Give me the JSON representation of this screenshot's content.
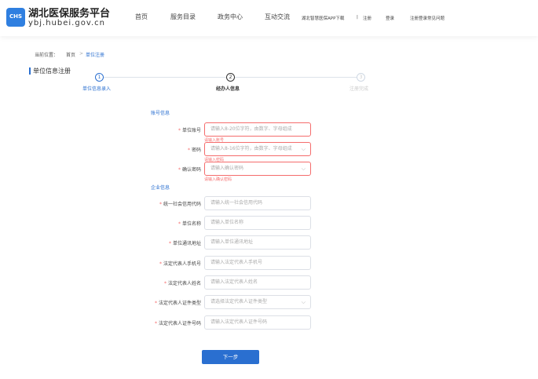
{
  "header": {
    "logo_text": "CHS",
    "title": "湖北医保服务平台",
    "domain": "ybj.hubei.gov.cn",
    "nav": [
      "首页",
      "服务目录",
      "政务中心",
      "互动交流"
    ],
    "links": {
      "app": "湖北智慧医保APP下载",
      "sep": "|",
      "register": "注册",
      "login": "登录",
      "faq": "注册登录常见问题"
    }
  },
  "breadcrumb": {
    "prefix": "当前位置：",
    "home": "首页",
    "sep": ">",
    "current": "单位注册"
  },
  "section_title": "单位信息注册",
  "steps": [
    {
      "num": "1",
      "label": "单位信息录入"
    },
    {
      "num": "2",
      "label": "经办人信息"
    },
    {
      "num": "3",
      "label": "注册完成"
    }
  ],
  "account": {
    "title": "账号信息",
    "fields": [
      {
        "label": "单位账号",
        "placeholder": "请输入8-20位字符，由数字、字母组成",
        "error": "请输入账号"
      },
      {
        "label": "密码",
        "placeholder": "请输入8-16位字符，由数字、字母组成",
        "error": "请输入密码"
      },
      {
        "label": "确认密码",
        "placeholder": "请输入确认密码",
        "error": "请输入确认密码"
      }
    ]
  },
  "company": {
    "title": "企业信息",
    "fields": [
      {
        "label": "统一社会信用代码",
        "placeholder": "请输入统一社会信用代码"
      },
      {
        "label": "单位名称",
        "placeholder": "请输入单位名称"
      },
      {
        "label": "单位通讯地址",
        "placeholder": "请输入单位通讯地址"
      },
      {
        "label": "法定代表人手机号",
        "placeholder": "请输入法定代表人手机号"
      },
      {
        "label": "法定代表人姓名",
        "placeholder": "请输入法定代表人姓名"
      },
      {
        "label": "法定代表人证件类型",
        "placeholder": "请选择法定代表人证件类型"
      },
      {
        "label": "法定代表人证件号码",
        "placeholder": "请输入法定代表人证件号码"
      }
    ]
  },
  "required_mark": "*",
  "next_button": "下一步"
}
